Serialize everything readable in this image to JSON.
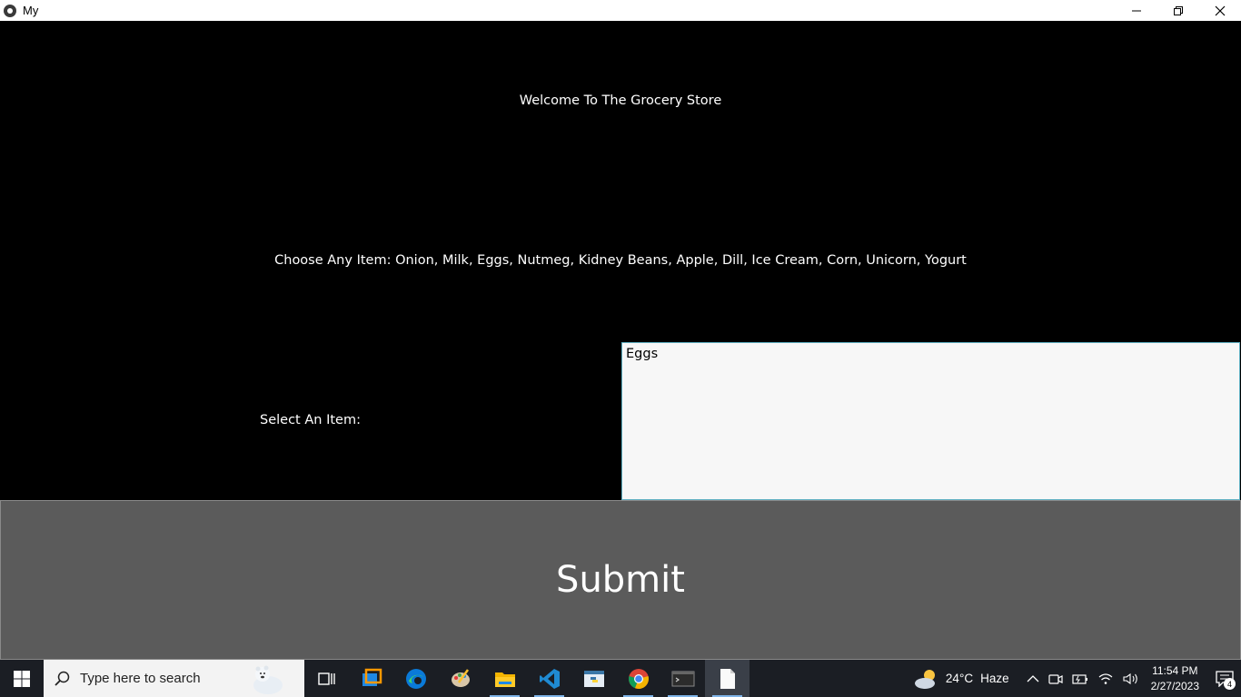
{
  "window": {
    "title": "My",
    "controls": [
      "minimize",
      "restore",
      "close"
    ]
  },
  "app": {
    "welcome_text": "Welcome To The Grocery Store",
    "choose_text": "Choose Any Item: Onion, Milk, Eggs, Nutmeg, Kidney Beans, Apple, Dill, Ice Cream, Corn, Unicorn, Yogurt",
    "select_label": "Select An Item:",
    "item_input_value": "Eggs",
    "submit_label": "Submit"
  },
  "taskbar": {
    "search_placeholder": "Type here to search",
    "pinned": [
      "task-view",
      "remote-desktop",
      "edge",
      "paint",
      "file-explorer",
      "vscode",
      "python",
      "chrome",
      "terminal",
      "notepad"
    ],
    "weather": {
      "temp": "24°C",
      "condition": "Haze"
    },
    "clock": {
      "time": "11:54 PM",
      "date": "2/27/2023"
    },
    "notifications_count": "4"
  },
  "colors": {
    "app_bg": "#000000",
    "input_bg": "#f7f7f7",
    "input_border": "#5fb0c2",
    "submit_bg": "#5b5b5b",
    "taskbar_bg": "#1b1e24"
  }
}
